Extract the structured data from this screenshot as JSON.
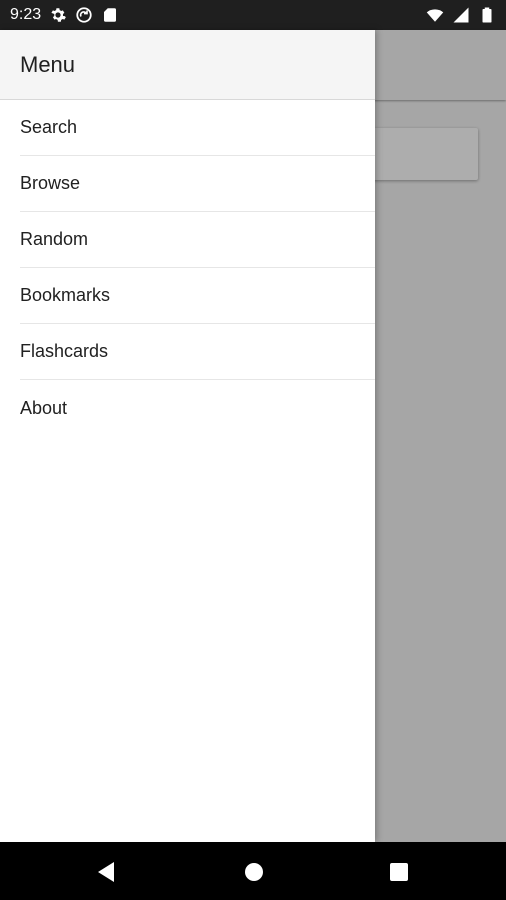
{
  "status_bar": {
    "time": "9:23",
    "left_icons": [
      "gear-icon",
      "sync-circle-icon",
      "sd-card-icon"
    ],
    "right_icons": [
      "wifi-icon",
      "signal-icon",
      "battery-icon"
    ]
  },
  "drawer": {
    "title": "Menu",
    "items": [
      {
        "label": "Search"
      },
      {
        "label": "Browse"
      },
      {
        "label": "Random"
      },
      {
        "label": "Bookmarks"
      },
      {
        "label": "Flashcards"
      },
      {
        "label": "About"
      }
    ]
  },
  "nav_bar": {
    "buttons": [
      "back-icon",
      "home-icon",
      "recents-icon"
    ]
  },
  "colors": {
    "status_bar": "#1f1f1f",
    "drawer_header": "#f5f5f5",
    "scrim": "#a6a6a6",
    "nav_bar": "#000000",
    "text": "#212121"
  }
}
